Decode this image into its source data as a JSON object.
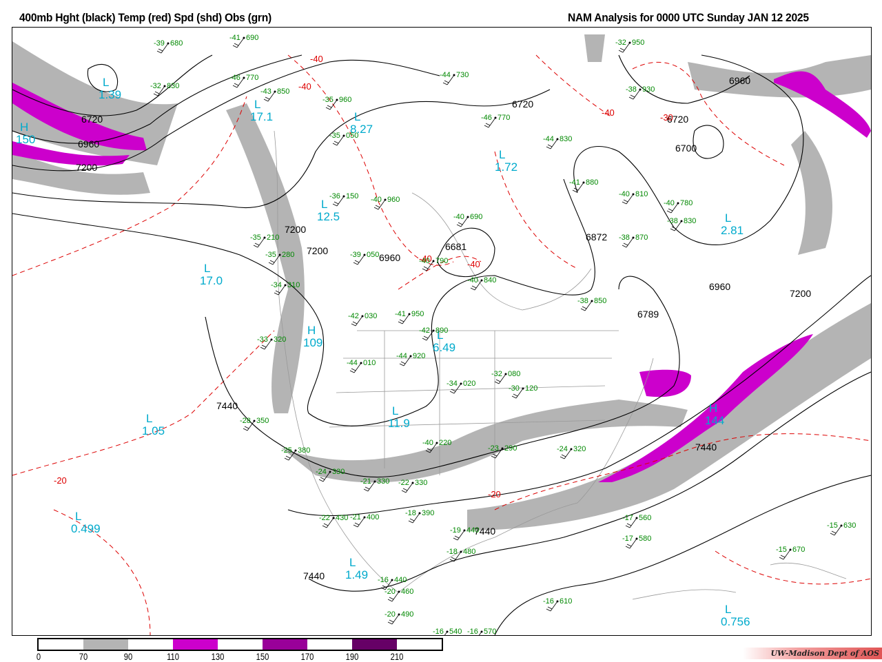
{
  "header": {
    "left_title": "400mb Hght (black) Temp (red) Spd (shd) Obs (grn)",
    "right_title": "NAM Analysis for 0000 UTC Sunday  JAN 12 2025"
  },
  "colors": {
    "speed_70_90": "#b4b4b4",
    "speed_110_130": "#cc00cc",
    "speed_150_170": "#990099",
    "speed_190_210": "#660066",
    "height": "#000000",
    "temp": "#dd0000",
    "obs": "#008800",
    "centers": "#00aacc"
  },
  "legend": {
    "ticks": [
      "0",
      "70",
      "90",
      "110",
      "130",
      "150",
      "170",
      "190",
      "210"
    ]
  },
  "credit": "UW-Madison   Dept of AOS",
  "height_labels": [
    "6720",
    "6960",
    "7200",
    "6720",
    "6960",
    "6720",
    "6700",
    "7200",
    "7200",
    "6960",
    "6681",
    "6872",
    "6789",
    "6960",
    "7200",
    "7440",
    "7440",
    "7440",
    "7440"
  ],
  "temp_labels": [
    "-40",
    "-40",
    "-40",
    "-40",
    "-30",
    "-20",
    "-20",
    "-40"
  ],
  "centers": [
    {
      "symbol": "L",
      "value": "1.39"
    },
    {
      "symbol": "H",
      "value": "150"
    },
    {
      "symbol": "L",
      "value": "17.0"
    },
    {
      "symbol": "L",
      "value": "1.05"
    },
    {
      "symbol": "L",
      "value": "0.499"
    },
    {
      "symbol": "H",
      "value": "109"
    },
    {
      "symbol": "L",
      "value": "12.5"
    },
    {
      "symbol": "L",
      "value": "11.9"
    },
    {
      "symbol": "L",
      "value": "1.49"
    },
    {
      "symbol": "L",
      "value": "0.756"
    },
    {
      "symbol": "H",
      "value": "144"
    },
    {
      "symbol": "L",
      "value": "2.81"
    },
    {
      "symbol": "L",
      "value": "17.1"
    },
    {
      "symbol": "L",
      "value": "8.27"
    },
    {
      "symbol": "L",
      "value": "6.49"
    },
    {
      "symbol": "L",
      "value": "1.72"
    }
  ],
  "observations": [
    {
      "t": "-39",
      "h": "680"
    },
    {
      "t": "-41",
      "h": "690"
    },
    {
      "t": "-32",
      "h": "830"
    },
    {
      "t": "-46",
      "h": "770"
    },
    {
      "t": "-43",
      "h": "850"
    },
    {
      "t": "-35",
      "h": "960"
    },
    {
      "t": "-35",
      "h": "050"
    },
    {
      "t": "-36",
      "h": "150"
    },
    {
      "t": "-40",
      "h": "960"
    },
    {
      "t": "-40",
      "h": "690"
    },
    {
      "t": "-44",
      "h": "730"
    },
    {
      "t": "-46",
      "h": "770"
    },
    {
      "t": "-44",
      "h": "830"
    },
    {
      "t": "-41",
      "h": "880"
    },
    {
      "t": "-40",
      "h": "810"
    },
    {
      "t": "-32",
      "h": "950"
    },
    {
      "t": "-38",
      "h": "930"
    },
    {
      "t": "-40",
      "h": "780"
    },
    {
      "t": "-38",
      "h": "830"
    },
    {
      "t": "-38",
      "h": "870"
    },
    {
      "t": "-35",
      "h": "210"
    },
    {
      "t": "-35",
      "h": "280"
    },
    {
      "t": "-34",
      "h": "310"
    },
    {
      "t": "-33",
      "h": "320"
    },
    {
      "t": "-39",
      "h": "050"
    },
    {
      "t": "-40",
      "h": "790"
    },
    {
      "t": "-40",
      "h": "840"
    },
    {
      "t": "-38",
      "h": "850"
    },
    {
      "t": "-42",
      "h": "030"
    },
    {
      "t": "-41",
      "h": "950"
    },
    {
      "t": "-42",
      "h": "890"
    },
    {
      "t": "-44",
      "h": "920"
    },
    {
      "t": "-44",
      "h": "010"
    },
    {
      "t": "-40",
      "h": "220"
    },
    {
      "t": "-34",
      "h": "020"
    },
    {
      "t": "-32",
      "h": "080"
    },
    {
      "t": "-30",
      "h": "120"
    },
    {
      "t": "-28",
      "h": "350"
    },
    {
      "t": "-25",
      "h": "380"
    },
    {
      "t": "-24",
      "h": "330"
    },
    {
      "t": "-21",
      "h": "330"
    },
    {
      "t": "-22",
      "h": "330"
    },
    {
      "t": "-23",
      "h": "290"
    },
    {
      "t": "-24",
      "h": "320"
    },
    {
      "t": "-22",
      "h": "430"
    },
    {
      "t": "-21",
      "h": "400"
    },
    {
      "t": "-18",
      "h": "390"
    },
    {
      "t": "-19",
      "h": "440"
    },
    {
      "t": "-18",
      "h": "480"
    },
    {
      "t": "-17",
      "h": "560"
    },
    {
      "t": "-17",
      "h": "580"
    },
    {
      "t": "-15",
      "h": "630"
    },
    {
      "t": "-15",
      "h": "670"
    },
    {
      "t": "-16",
      "h": "610"
    },
    {
      "t": "-20",
      "h": "460"
    },
    {
      "t": "-20",
      "h": "490"
    },
    {
      "t": "-16",
      "h": "540"
    },
    {
      "t": "-16",
      "h": "570"
    },
    {
      "t": "-16",
      "h": "440"
    }
  ]
}
